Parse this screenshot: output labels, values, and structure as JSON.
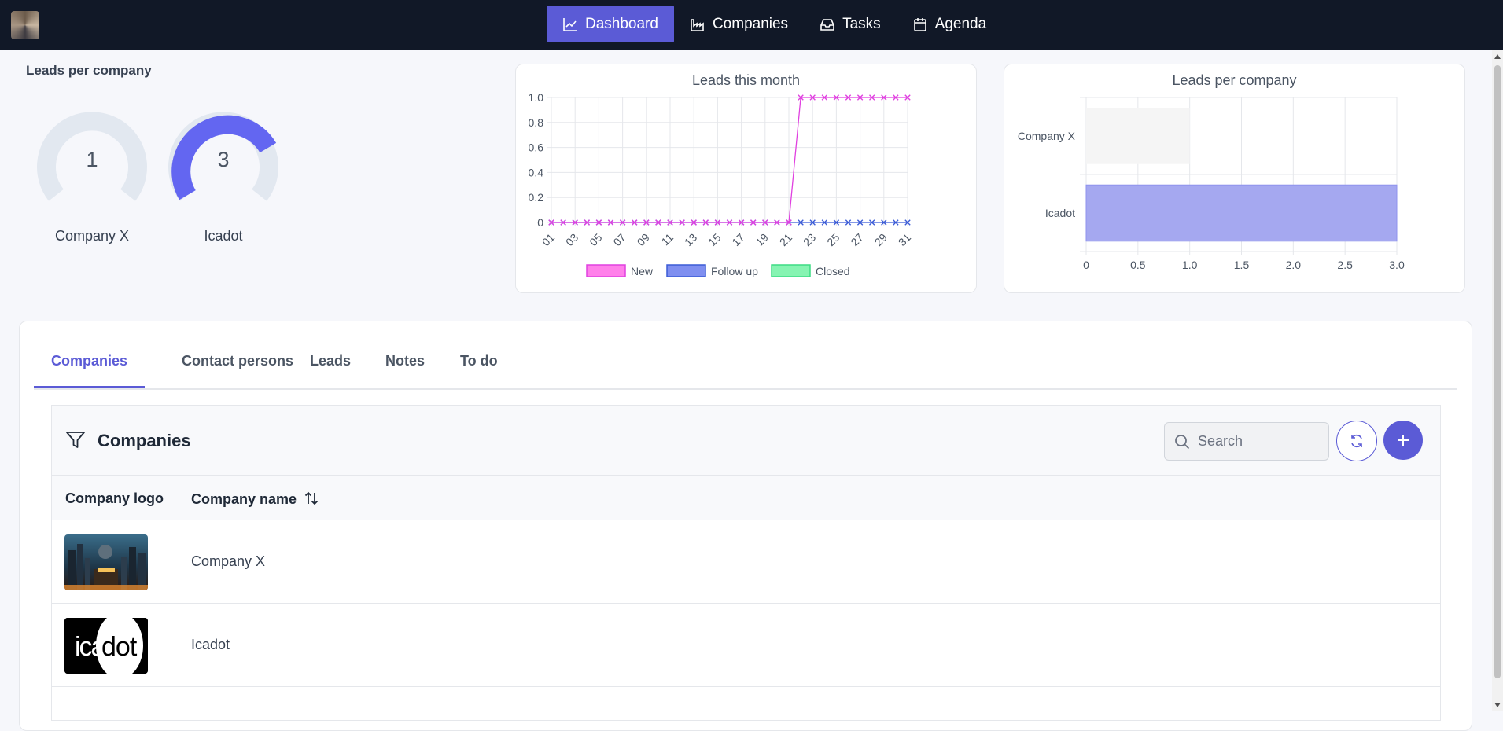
{
  "nav": {
    "items": [
      {
        "label": "Dashboard",
        "icon": "chart-line-icon",
        "active": true
      },
      {
        "label": "Companies",
        "icon": "factory-icon",
        "active": false
      },
      {
        "label": "Tasks",
        "icon": "inbox-icon",
        "active": false
      },
      {
        "label": "Agenda",
        "icon": "calendar-icon",
        "active": false
      }
    ]
  },
  "donuts": {
    "title": "Leads per company",
    "items": [
      {
        "value": "1",
        "label": "Company X",
        "fraction": 0.0
      },
      {
        "value": "3",
        "label": "Icadot",
        "fraction": 1.0
      }
    ]
  },
  "chart_data": [
    {
      "type": "line",
      "title": "Leads this month",
      "x": [
        "01",
        "02",
        "03",
        "04",
        "05",
        "06",
        "07",
        "08",
        "09",
        "10",
        "11",
        "12",
        "13",
        "14",
        "15",
        "16",
        "17",
        "18",
        "19",
        "20",
        "21",
        "22",
        "23",
        "24",
        "25",
        "26",
        "27",
        "28",
        "29",
        "30",
        "31"
      ],
      "x_tick_labels": [
        "01",
        "03",
        "05",
        "07",
        "09",
        "11",
        "13",
        "15",
        "17",
        "19",
        "21",
        "23",
        "25",
        "27",
        "29",
        "31"
      ],
      "ylim": [
        0,
        1.0
      ],
      "y_ticks": [
        "0",
        "0.2",
        "0.4",
        "0.6",
        "0.8",
        "1.0"
      ],
      "grid": true,
      "legend": "bottom",
      "series": [
        {
          "name": "New",
          "color": "#e040e0",
          "values": [
            0,
            0,
            0,
            0,
            0,
            0,
            0,
            0,
            0,
            0,
            0,
            0,
            0,
            0,
            0,
            0,
            0,
            0,
            0,
            0,
            0,
            1,
            1,
            1,
            1,
            1,
            1,
            1,
            1,
            1,
            1
          ]
        },
        {
          "name": "Follow up",
          "color": "#3b5bd6",
          "values": [
            0,
            0,
            0,
            0,
            0,
            0,
            0,
            0,
            0,
            0,
            0,
            0,
            0,
            0,
            0,
            0,
            0,
            0,
            0,
            0,
            0,
            0,
            0,
            0,
            0,
            0,
            0,
            0,
            0,
            0,
            0
          ]
        },
        {
          "name": "Closed",
          "color": "#3ddc84",
          "values": []
        }
      ]
    },
    {
      "type": "bar",
      "orientation": "horizontal",
      "title": "Leads per company",
      "categories": [
        "Company X",
        "Icadot"
      ],
      "values": [
        1,
        3
      ],
      "bar_colors": [
        "#f5f5f5",
        "#a5a8f0"
      ],
      "xlim": [
        0,
        3.0
      ],
      "x_ticks": [
        "0",
        "0.5",
        "1.0",
        "1.5",
        "2.0",
        "2.5",
        "3.0"
      ],
      "grid": true
    }
  ],
  "tabs": [
    {
      "label": "Companies",
      "active": true
    },
    {
      "label": "Contact persons",
      "active": false
    },
    {
      "label": "Leads",
      "active": false
    },
    {
      "label": "Notes",
      "active": false
    },
    {
      "label": "To do",
      "active": false
    }
  ],
  "panel": {
    "title": "Companies",
    "search_placeholder": "Search",
    "columns": [
      "Company logo",
      "Company name"
    ],
    "rows": [
      {
        "name": "Company X",
        "logo": "city-illustration"
      },
      {
        "name": "Icadot",
        "logo_text_left": "ica",
        "logo_text_right": "dot"
      }
    ]
  }
}
